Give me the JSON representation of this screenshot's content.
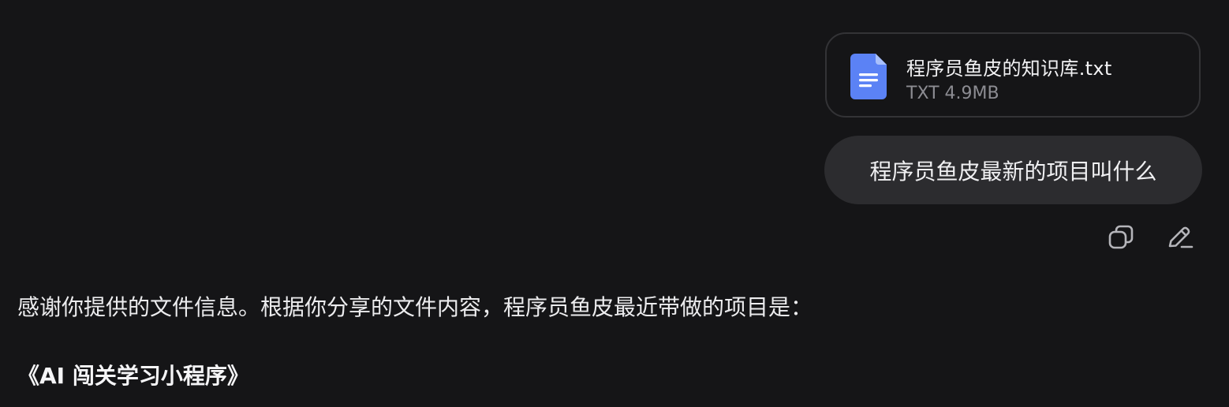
{
  "attachment": {
    "file_name": "程序员鱼皮的知识库.txt",
    "file_meta": "TXT 4.9MB",
    "icon": "document-icon",
    "icon_color": "#5b82f5"
  },
  "user_message": {
    "text": "程序员鱼皮最新的项目叫什么"
  },
  "message_actions": {
    "copy_icon": "copy-icon",
    "edit_icon": "pencil-icon"
  },
  "assistant_message": {
    "paragraph": "感谢你提供的文件信息。根据你分享的文件内容，程序员鱼皮最近带做的项目是：",
    "project_title": "《AI 闯关学习小程序》"
  },
  "colors": {
    "background": "#151517",
    "bubble": "#2c2c2f",
    "card_border": "#333336",
    "muted_text": "#8c8c92"
  }
}
